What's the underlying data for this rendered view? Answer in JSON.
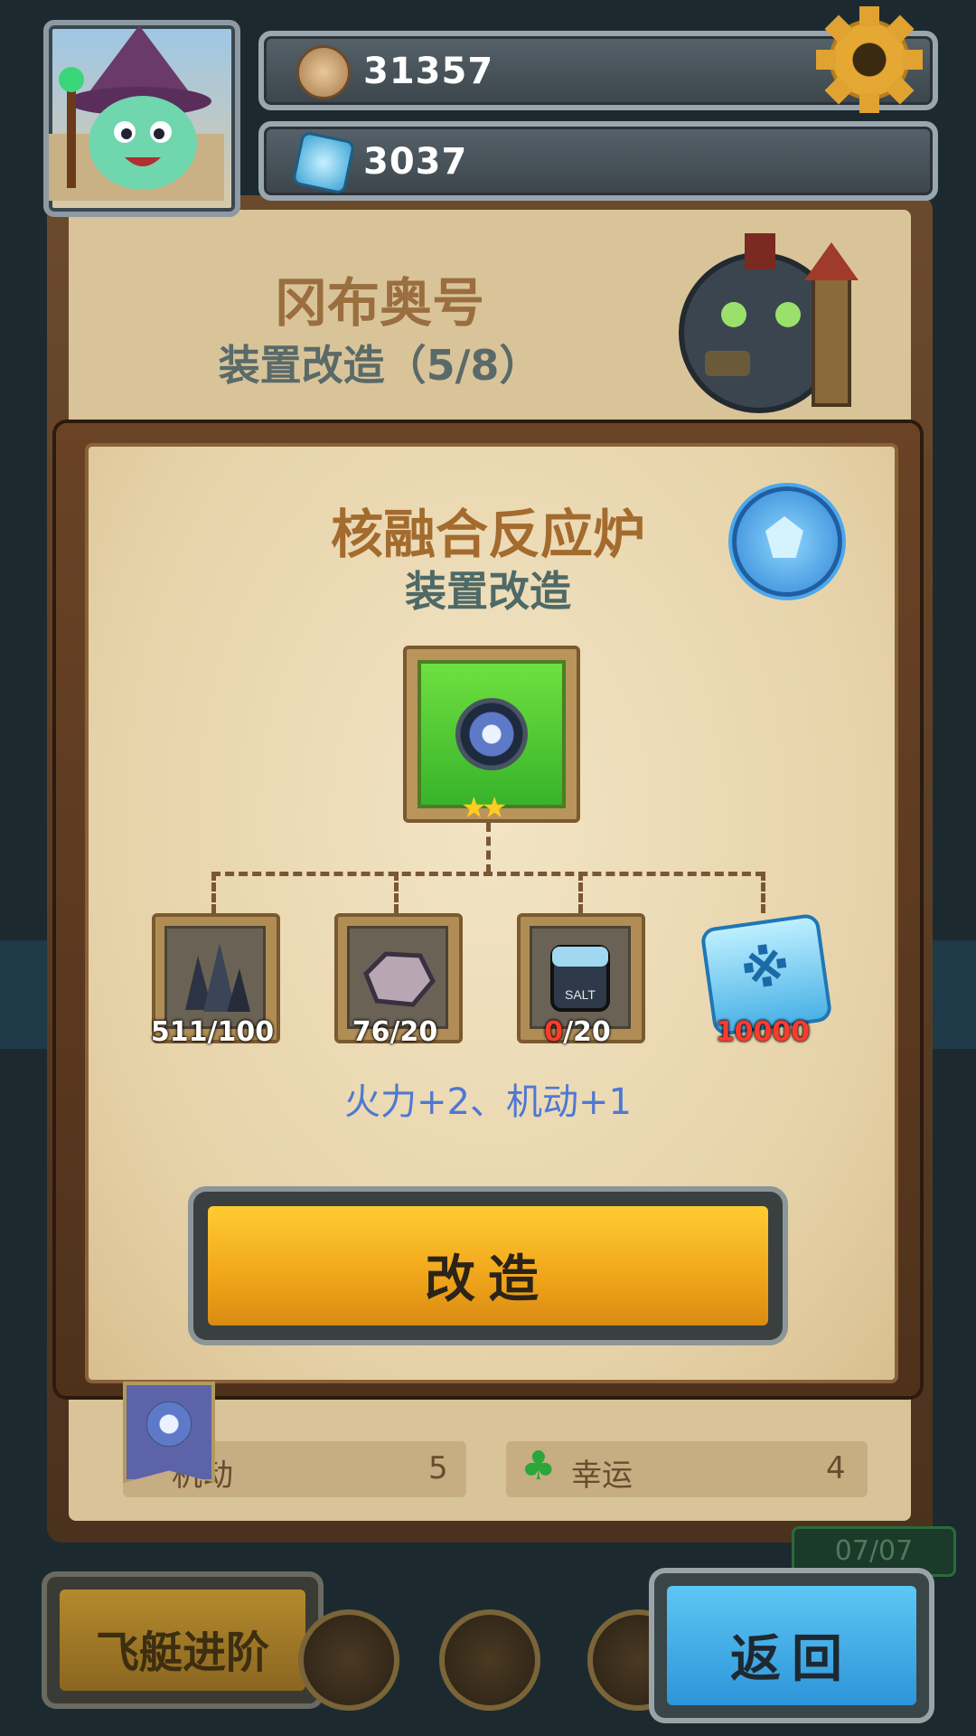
{
  "currency": {
    "coins": "31357",
    "gems": "3037"
  },
  "ship": {
    "name": "冈布奥号",
    "subtitle": "装置改造（5/8）"
  },
  "modal": {
    "title": "核融合反应炉",
    "subtitle": "装置改造",
    "main_item_icon": "lens-device-icon",
    "main_item_stars": "★★",
    "materials": [
      {
        "icon": "dark-crystal-icon",
        "count_have": "511",
        "count_need": "/100"
      },
      {
        "icon": "ore-stone-icon",
        "count_have": "76",
        "count_need": "/20"
      },
      {
        "icon": "salt-jar-icon",
        "count_have": "0",
        "count_need": "/20"
      },
      {
        "icon": "blue-gem-icon",
        "count_have": "10000",
        "count_need": ""
      }
    ],
    "effect": "火力+2、机动+1",
    "modify_button": "改造"
  },
  "stats": {
    "row1_left_label": "机动",
    "row1_left_value": "5",
    "row1_right_label": "幸运",
    "row1_right_value": "4"
  },
  "bottom": {
    "advance_button": "飞艇进阶",
    "back_button": "返回",
    "timer": "07/07"
  },
  "colors": {
    "accent_gold": "#f0a51a",
    "accent_blue": "#2d95d9",
    "effect_text": "#4e78d4",
    "insufficient": "#ff3a2c"
  }
}
